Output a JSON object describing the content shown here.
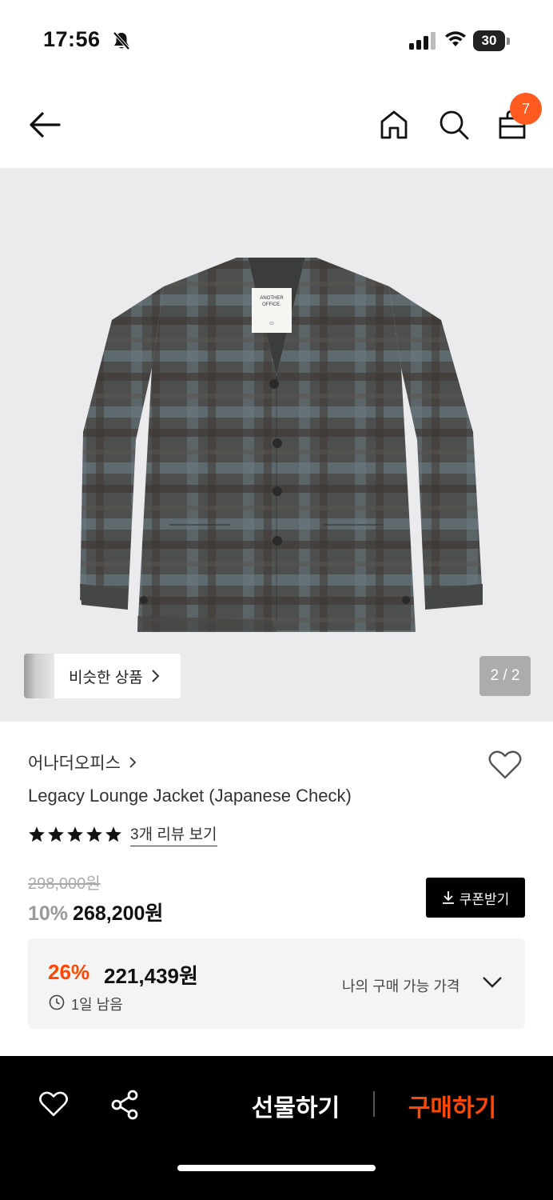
{
  "status_bar": {
    "time": "17:56",
    "battery": "30"
  },
  "header": {
    "cart_count": "7"
  },
  "gallery": {
    "similar_label": "비슷한 상품",
    "page_indicator": "2 / 2",
    "current_image": 2,
    "total_images": 2,
    "image_alt": "ANOTHER OFFICE",
    "tag_size": "02"
  },
  "product": {
    "brand": "어나더오피스",
    "title": "Legacy Lounge Jacket (Japanese Check)",
    "rating_stars": 5,
    "review_link": "3개 리뷰 보기",
    "original_price": "298,000원",
    "discount_rate": "10%",
    "sale_price": "268,200원",
    "coupon_label": "쿠폰받기"
  },
  "my_price": {
    "rate": "26%",
    "price": "221,439원",
    "remaining": "1일 남음",
    "label": "나의 구매 가능 가격"
  },
  "bottom_bar": {
    "gift_label": "선물하기",
    "buy_label": "구매하기"
  },
  "colors": {
    "accent": "#ff4800",
    "badge": "#ff5a1f",
    "image_bg": "#ebebed"
  }
}
